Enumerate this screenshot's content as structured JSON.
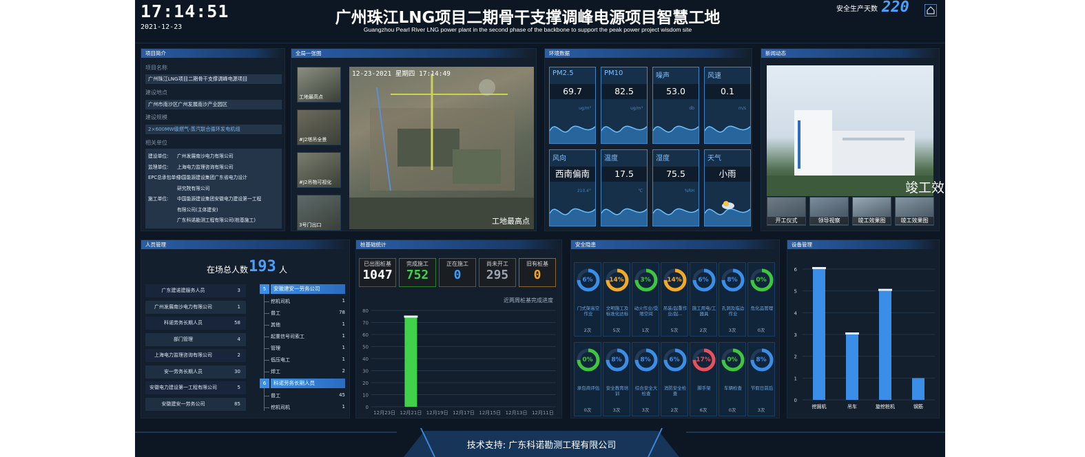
{
  "header": {
    "time": "17:14:51",
    "date": "2021-12-23",
    "title": "广州珠江LNG项目二期骨干支撑调峰电源项目智慧工地",
    "subtitle": "Guangzhou Pearl River LNG power plant in the second phase of the backbone to support the peak power project wisdom site",
    "safe_label": "安全生产天数",
    "safe_days": "220"
  },
  "project": {
    "title": "项目简介",
    "name_label": "项目名称",
    "name": "广州珠江LNG项目二期骨干支撑调峰电源项目",
    "site_label": "建设地点",
    "site": "广州市南沙区广州发展南沙产业园区",
    "scale_label": "建设规模",
    "scale": "2×600MW级燃气-蒸汽联合循环发电机组",
    "units_label": "相关单位",
    "units": [
      [
        "建设单位:",
        "广州发展南沙电力有限公司"
      ],
      [
        "监理单位:",
        "上海电力监理咨询有限公司"
      ],
      [
        "EPC总承包单位:",
        "中国能源建设集团广东省电力设计"
      ],
      [
        "",
        "研究院有限公司"
      ],
      [
        "施工单位:",
        "中国能源建设集团安徽电力建设第一工程"
      ],
      [
        "",
        "有限公司(主体建安)"
      ],
      [
        "",
        "广东科诺勘测工程有限公司(桩基施工)"
      ]
    ]
  },
  "overview": {
    "title": "全局一张图",
    "stamp": "12-23-2021 星期四 17:14:49",
    "watermark": "工地最高点",
    "thumbs": [
      "工地最高点",
      "#J2塔吊全景",
      "#J2吊物可视化",
      "3号门出口"
    ]
  },
  "env": {
    "title": "环境数据",
    "items": [
      {
        "name": "PM2.5",
        "value": "69.7",
        "unit": "ug/m³"
      },
      {
        "name": "PM10",
        "value": "82.5",
        "unit": "ug/m³"
      },
      {
        "name": "噪声",
        "value": "53.0",
        "unit": "db"
      },
      {
        "name": "风速",
        "value": "0.1",
        "unit": "m/s"
      },
      {
        "name": "风向",
        "value": "西南偏南",
        "unit": "210.4°"
      },
      {
        "name": "温度",
        "value": "17.5",
        "unit": "℃"
      },
      {
        "name": "湿度",
        "value": "75.5",
        "unit": "%RH"
      },
      {
        "name": "天气",
        "value": "小雨",
        "unit": ""
      }
    ]
  },
  "news": {
    "title": "新闻动态",
    "caption": "竣工效果图",
    "thumbs": [
      "开工仪式",
      "领导视察",
      "竣工效果图",
      "竣工效果图"
    ]
  },
  "personnel": {
    "title": "人员管理",
    "total_label": "在场总人数",
    "total": "193",
    "unit": "人",
    "rows": [
      [
        "广东建诺建服务人员",
        "3"
      ],
      [
        "广州发展南沙电力有限公司",
        "1"
      ],
      [
        "科诺劳务长期人员",
        "58"
      ],
      [
        "部门管理",
        "4"
      ],
      [
        "上海电力监理咨询有限公司",
        "2"
      ],
      [
        "安一劳务长期人员",
        "30"
      ],
      [
        "安徽电力建设第一工程有限公司",
        "5"
      ],
      [
        "安徽建安一劳务公司",
        "85"
      ]
    ],
    "groupA": {
      "badge": "5",
      "name": "安徽建安一劳务公司",
      "items": [
        [
          "挖机司机",
          "1"
        ],
        [
          "普工",
          "78"
        ],
        [
          "其他",
          "1"
        ],
        [
          "起重信号司索工",
          "1"
        ],
        [
          "管理",
          "1"
        ],
        [
          "低压电工",
          "1"
        ],
        [
          "焊工",
          "2"
        ]
      ]
    },
    "groupB": {
      "badge": "6",
      "name": "科诺劳务长期人员",
      "items": [
        [
          "普工",
          "45"
        ],
        [
          "挖机司机",
          "1"
        ]
      ]
    }
  },
  "piles": {
    "title": "桩基础统计",
    "boxes": [
      {
        "label": "已出图桩基",
        "value": "1047",
        "color": "#ffffff"
      },
      {
        "label": "完成施工",
        "value": "752",
        "color": "#3fd24a"
      },
      {
        "label": "正在施工",
        "value": "0",
        "color": "#3aa0ff"
      },
      {
        "label": "尚未开工",
        "value": "295",
        "color": "#9aa4af"
      },
      {
        "label": "旧有桩基",
        "value": "0",
        "color": "#f0a92a"
      }
    ],
    "chart_title": "近两周桩基完成进度"
  },
  "safety": {
    "title": "安全隐患",
    "items": [
      {
        "name": "门式架高空作业",
        "pct": "6%",
        "cnt": "2次",
        "color": "#3b8ee8"
      },
      {
        "name": "文明施工及标准化达标",
        "pct": "14%",
        "cnt": "5次",
        "color": "#f0a92a"
      },
      {
        "name": "动火作业/受限空间",
        "pct": "3%",
        "cnt": "1次",
        "color": "#3fc63f"
      },
      {
        "name": "吊装/起重作业/起...",
        "pct": "14%",
        "cnt": "5次",
        "color": "#f0a92a"
      },
      {
        "name": "施工用电/工器具",
        "pct": "6%",
        "cnt": "2次",
        "color": "#3b8ee8"
      },
      {
        "name": "孔洞及临边作业",
        "pct": "8%",
        "cnt": "3次",
        "color": "#3b8ee8"
      },
      {
        "name": "危化品管理",
        "pct": "0%",
        "cnt": "0次",
        "color": "#3fc63f"
      },
      {
        "name": "承包商评估",
        "pct": "0%",
        "cnt": "0次",
        "color": "#3fc63f"
      },
      {
        "name": "安全教育培训",
        "pct": "8%",
        "cnt": "3次",
        "color": "#3b8ee8"
      },
      {
        "name": "综合安全大检查",
        "pct": "8%",
        "cnt": "3次",
        "color": "#3b8ee8"
      },
      {
        "name": "消防安全检查",
        "pct": "6%",
        "cnt": "2次",
        "color": "#3b8ee8"
      },
      {
        "name": "脚手架",
        "pct": "17%",
        "cnt": "6次",
        "color": "#e8505b"
      },
      {
        "name": "车辆检查",
        "pct": "0%",
        "cnt": "0次",
        "color": "#3fc63f"
      },
      {
        "name": "节假日前后",
        "pct": "8%",
        "cnt": "3次",
        "color": "#3b8ee8"
      }
    ]
  },
  "equipment": {
    "title": "设备管理"
  },
  "footer": {
    "text": "技术支持: 广东科诺勘测工程有限公司"
  },
  "chart_data": [
    {
      "type": "bar",
      "title": "近两周桩基完成进度",
      "categories": [
        "12月23日",
        "12月21日",
        "12月19日",
        "12月17日",
        "12月15日",
        "12月13日",
        "12月11日"
      ],
      "values": [
        0,
        74,
        0,
        0,
        0,
        0,
        0
      ],
      "ylim": [
        0,
        80
      ],
      "yticks": [
        0,
        10,
        20,
        30,
        40,
        50,
        60,
        70,
        80
      ],
      "color": "#3fd24a"
    },
    {
      "type": "bar",
      "title": "设备管理",
      "categories": [
        "挖掘机",
        "吊车",
        "旋挖桩机",
        "钢筋"
      ],
      "values": [
        6,
        3,
        5,
        1
      ],
      "ylim": [
        0,
        6
      ],
      "yticks": [
        0,
        1,
        2,
        3,
        4,
        5,
        6
      ],
      "color": "#3b8ee8"
    }
  ]
}
